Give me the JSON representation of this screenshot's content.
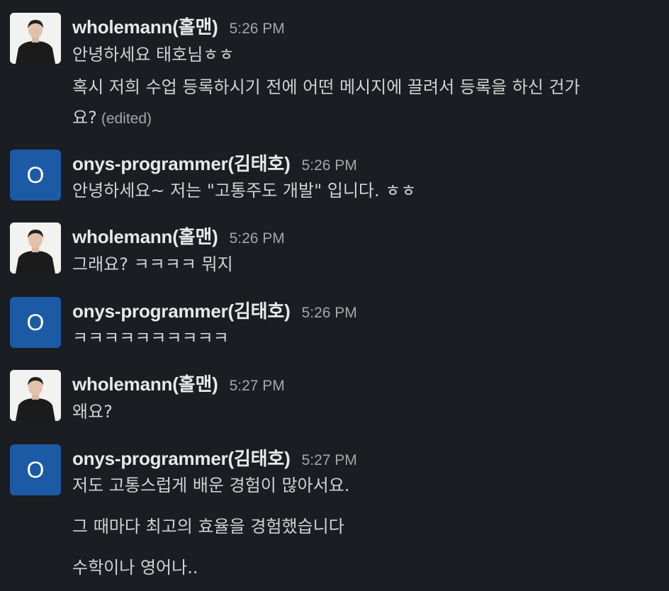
{
  "messages": [
    {
      "author": "wholemann(홀맨)",
      "time": "5:26 PM",
      "avatar": "photo",
      "lines": [
        "안녕하세요 태호님ㅎㅎ",
        "혹시 저희 수업 등록하시기 전에 어떤 메시지에 끌려서 등록을 하신 건가",
        "요?"
      ],
      "edited_label": "(edited)"
    },
    {
      "author": "onys-programmer(김태호)",
      "time": "5:26 PM",
      "avatar": "initial",
      "avatar_letter": "O",
      "lines": [
        "안녕하세요~ 저는 \"고통주도 개발\" 입니다. ㅎㅎ"
      ]
    },
    {
      "author": "wholemann(홀맨)",
      "time": "5:26 PM",
      "avatar": "photo",
      "lines": [
        "그래요? ㅋㅋㅋㅋ 뭐지"
      ]
    },
    {
      "author": "onys-programmer(김태호)",
      "time": "5:26 PM",
      "avatar": "initial",
      "avatar_letter": "O",
      "lines": [
        "ㅋㅋㅋㅋㅋㅋㅋㅋㅋㅋ"
      ]
    },
    {
      "author": "wholemann(홀맨)",
      "time": "5:27 PM",
      "avatar": "photo",
      "lines": [
        "왜요?"
      ]
    },
    {
      "author": "onys-programmer(김태호)",
      "time": "5:27 PM",
      "avatar": "initial",
      "avatar_letter": "O",
      "lines": [
        "저도 고통스럽게 배운 경험이 많아서요.",
        "그 때마다 최고의 효율을 경험했습니다",
        "수학이나 영어나.."
      ]
    }
  ],
  "colors": {
    "background": "#1a1d21",
    "text": "#d1d2d3",
    "name": "#e8e8e8",
    "muted": "#a5a6a7",
    "avatar_blue": "#1d5aa6"
  }
}
